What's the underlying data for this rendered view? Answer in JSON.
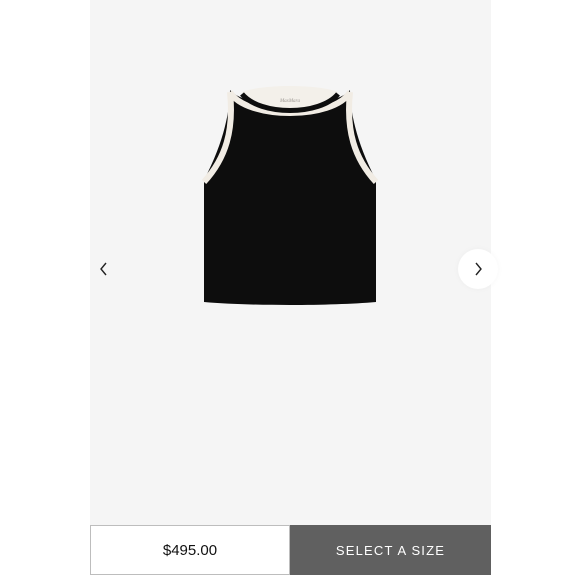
{
  "product": {
    "image_icon": "sleeveless-knit-top-image",
    "brand_mark": "MaxMara",
    "colors": {
      "garment": "#0d0d0d",
      "trim": "#f1ece4",
      "lining": "#f3f0ea"
    }
  },
  "carousel": {
    "prev_icon": "chevron-left-icon",
    "next_icon": "chevron-right-icon",
    "prev_glyph": "‹",
    "next_glyph": "›"
  },
  "purchase_bar": {
    "price": "$495.00",
    "size_button_label": "SELECT A SIZE",
    "button_color": "#606060"
  }
}
